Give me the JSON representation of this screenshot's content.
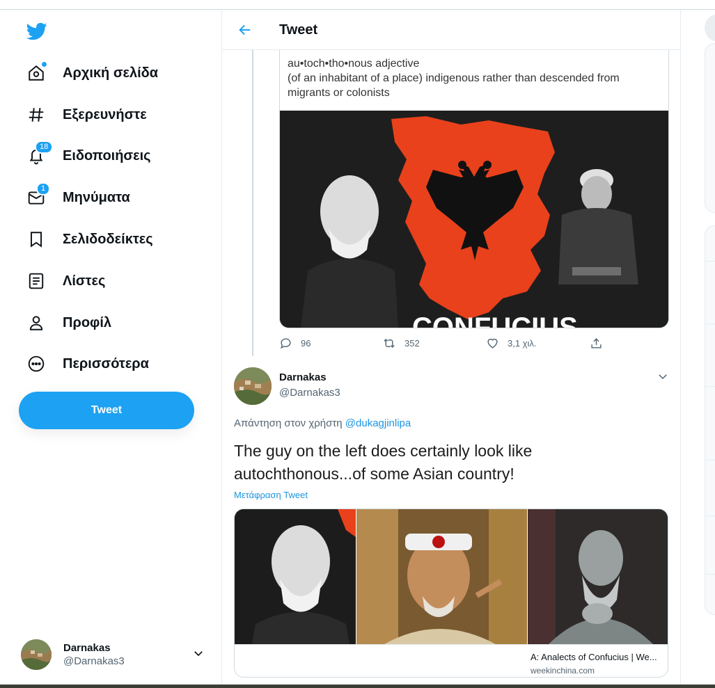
{
  "sidebar": {
    "items": [
      {
        "label": "Αρχική σελίδα",
        "icon": "home-icon",
        "badge": ""
      },
      {
        "label": "Εξερευνήστε",
        "icon": "hashtag-icon",
        "badge": ""
      },
      {
        "label": "Ειδοποιήσεις",
        "icon": "bell-icon",
        "badge": "18"
      },
      {
        "label": "Μηνύματα",
        "icon": "envelope-icon",
        "badge": "1"
      },
      {
        "label": "Σελιδοδείκτες",
        "icon": "bookmark-icon",
        "badge": ""
      },
      {
        "label": "Λίστες",
        "icon": "list-icon",
        "badge": ""
      },
      {
        "label": "Προφίλ",
        "icon": "person-icon",
        "badge": ""
      },
      {
        "label": "Περισσότερα",
        "icon": "more-circle-icon",
        "badge": ""
      }
    ],
    "tweet_button": "Tweet",
    "account": {
      "name": "Darnakas",
      "handle": "@Darnakas3"
    }
  },
  "header": {
    "title": "Tweet"
  },
  "quoted": {
    "definition": {
      "headword": "au•toch•tho•nous  adjective",
      "line1": "(of an inhabitant of a place) indigenous rather than descended from",
      "line2": "migrants or colonists"
    },
    "stats": {
      "replies": "96",
      "retweets": "352",
      "likes": "3,1 χιλ."
    }
  },
  "reply": {
    "name": "Darnakas",
    "handle": "@Darnakas3",
    "replying_prefix": "Απάντηση στον χρήστη",
    "replying_to": "@dukagjinlipa",
    "text_line1": "The guy on the left does certainly look like",
    "text_line2": "autochthonous...of some Asian country!",
    "translate": "Μετάφραση Tweet",
    "card": {
      "title": "A: Analects of Confucius | We...",
      "domain": "weekinchina.com"
    }
  },
  "colors": {
    "accent": "#1da1f2",
    "link": "#1b95e0",
    "secondary_text": "#536471",
    "flag_red": "#e8411c"
  }
}
